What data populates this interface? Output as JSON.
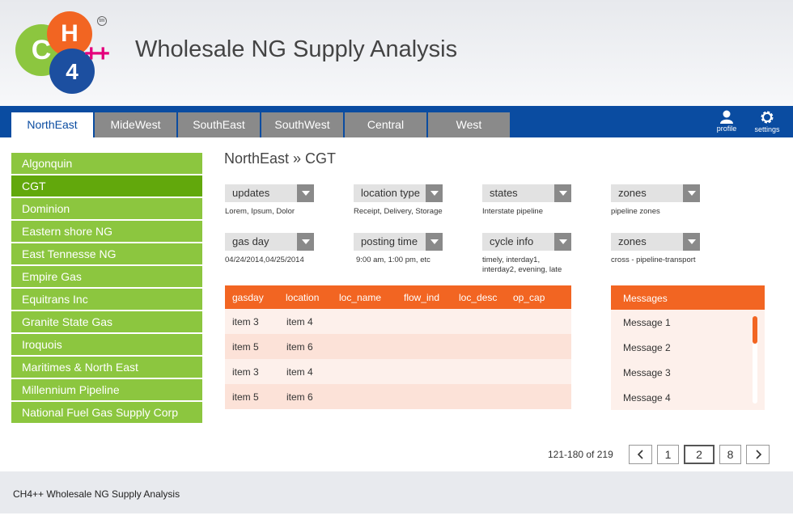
{
  "header": {
    "logo": {
      "c": "C",
      "h": "H",
      "n": "4",
      "plus": "++",
      "tm": "tm"
    },
    "title": "Wholesale NG Supply Analysis"
  },
  "nav": {
    "tabs": [
      {
        "label": "NorthEast",
        "active": true
      },
      {
        "label": "MideWest"
      },
      {
        "label": "SouthEast"
      },
      {
        "label": "SouthWest"
      },
      {
        "label": "Central"
      },
      {
        "label": "West"
      }
    ],
    "profile_label": "profile",
    "settings_label": "settings"
  },
  "sidebar": {
    "items": [
      {
        "label": "Algonquin"
      },
      {
        "label": "CGT",
        "active": true
      },
      {
        "label": "Dominion"
      },
      {
        "label": "Eastern shore NG"
      },
      {
        "label": "East Tennesse NG"
      },
      {
        "label": "Empire Gas"
      },
      {
        "label": "Equitrans Inc"
      },
      {
        "label": "Granite State Gas"
      },
      {
        "label": "Iroquois"
      },
      {
        "label": "Maritimes & North East"
      },
      {
        "label": "Millennium Pipeline"
      },
      {
        "label": "National Fuel Gas Supply Corp"
      }
    ]
  },
  "breadcrumb": "NorthEast » CGT",
  "filters": [
    {
      "label": "updates",
      "desc": "Lorem, Ipsum, Dolor"
    },
    {
      "label": "location type",
      "desc": "Receipt, Delivery, Storage"
    },
    {
      "label": "states",
      "desc": "Interstate pipeline"
    },
    {
      "label": "zones",
      "desc": "pipeline zones"
    },
    {
      "label": "gas day",
      "desc": "04/24/2014,04/25/2014"
    },
    {
      "label": "posting time",
      "desc": "9:00 am, 1:00 pm, etc"
    },
    {
      "label": "cycle info",
      "desc1": "timely, interday1,",
      "desc2": "interday2, evening, late"
    },
    {
      "label": "zones",
      "desc": "cross - pipeline-transport"
    }
  ],
  "table": {
    "columns": [
      "gasday",
      "location",
      "loc_name",
      "flow_ind",
      "loc_desc",
      "op_cap"
    ],
    "rows": [
      [
        "item 3",
        "item 4"
      ],
      [
        "item 5",
        "item 6"
      ],
      [
        "item 3",
        "item 4"
      ],
      [
        "item 5",
        "item 6"
      ]
    ]
  },
  "messages": {
    "title": "Messages",
    "items": [
      "Message 1",
      "Message 2",
      "Message 3",
      "Message 4"
    ]
  },
  "pagination": {
    "info": "121-180 of 219",
    "pages": [
      "1",
      "2",
      "8"
    ],
    "current": "2"
  },
  "footer": {
    "text": "CH4++ Wholesale NG Supply Analysis"
  },
  "colors": {
    "brand_blue": "#0a4ca1",
    "green": "#8cc63f",
    "green_active": "#62a80c",
    "orange": "#f26522",
    "magenta": "#e4007c"
  }
}
